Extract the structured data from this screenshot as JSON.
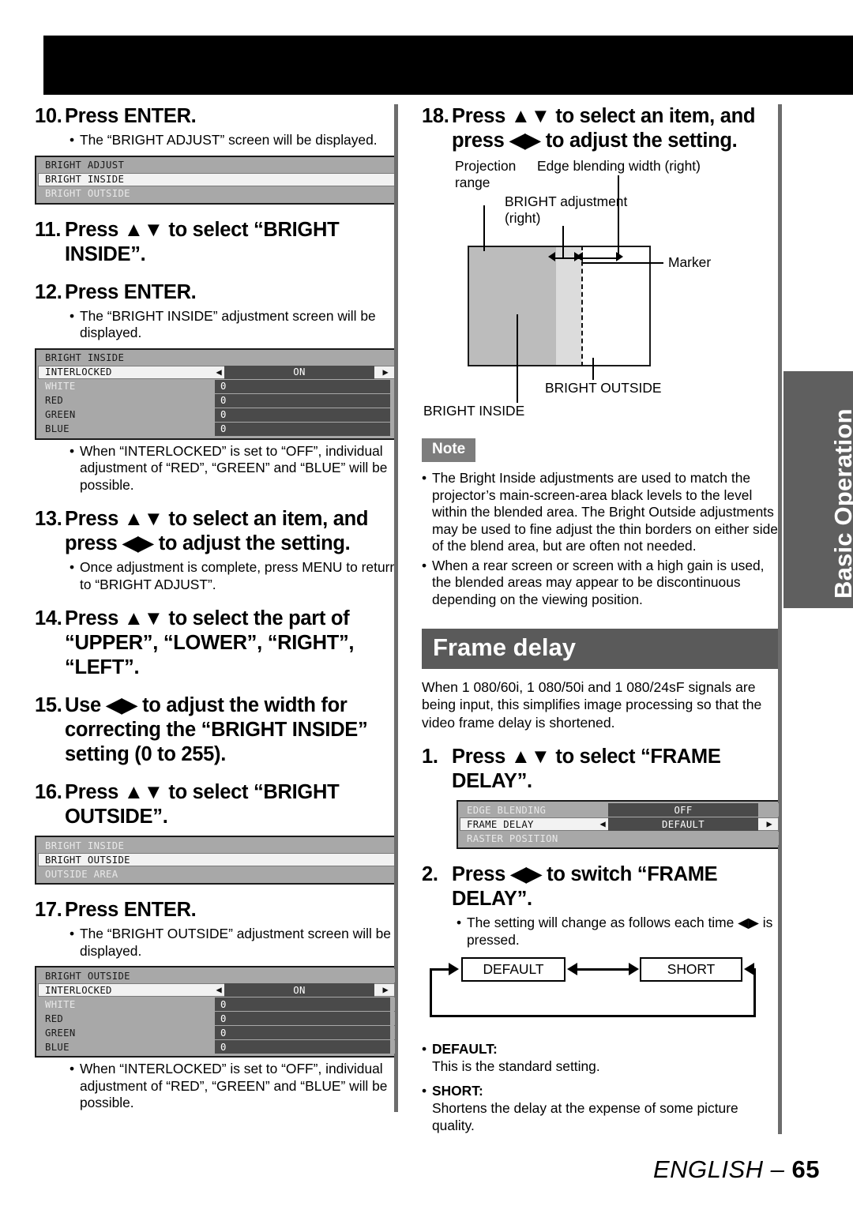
{
  "page": {
    "footer_label": "ENGLISH –",
    "footer_page": "65",
    "side_tab": "Basic Operation"
  },
  "left_column": {
    "step10": {
      "num": "10.",
      "text": "Press ENTER.",
      "bullet": "The “BRIGHT ADJUST” screen will be displayed.",
      "osd": {
        "name": "bright-adjust-menu",
        "title": "BRIGHT ADJUST",
        "rows": [
          {
            "label": "BRIGHT INSIDE",
            "state": "selected"
          },
          {
            "label": "BRIGHT OUTSIDE",
            "state": "dim"
          }
        ]
      }
    },
    "step11": {
      "num": "11.",
      "text": "Press ▲▼ to select “BRIGHT INSIDE”."
    },
    "step12": {
      "num": "12.",
      "text": "Press ENTER.",
      "bullet": "The “BRIGHT INSIDE” adjustment screen will be displayed.",
      "osd": {
        "name": "bright-inside-menu",
        "title": "BRIGHT INSIDE",
        "rows": [
          {
            "label": "INTERLOCKED",
            "value": "ON",
            "state": "selected",
            "arrows": true
          },
          {
            "label": "WHITE",
            "value": "0",
            "state": "dim"
          },
          {
            "label": "RED",
            "value": "0",
            "state": "plain"
          },
          {
            "label": "GREEN",
            "value": "0",
            "state": "plain"
          },
          {
            "label": "BLUE",
            "value": "0",
            "state": "plain"
          }
        ]
      },
      "note_bullet": "When “INTERLOCKED” is set to “OFF”, individual adjustment of “RED”, “GREEN” and “BLUE” will be possible."
    },
    "step13": {
      "num": "13.",
      "text": "Press ▲▼ to select an item, and press ◀▶ to adjust the setting.",
      "bullet": "Once adjustment is complete, press MENU to return to “BRIGHT ADJUST”."
    },
    "step14": {
      "num": "14.",
      "text": "Press ▲▼ to select the part of “UPPER”, “LOWER”, “RIGHT”, “LEFT”."
    },
    "step15": {
      "num": "15.",
      "text": "Use ◀▶ to adjust the width for correcting the “BRIGHT INSIDE” setting (0 to 255)."
    },
    "step16": {
      "num": "16.",
      "text": "Press ▲▼ to select “BRIGHT OUTSIDE”.",
      "osd": {
        "name": "bright-outside-select-menu",
        "rows": [
          {
            "label": "BRIGHT INSIDE",
            "state": "dim"
          },
          {
            "label": "BRIGHT OUTSIDE",
            "state": "selected"
          },
          {
            "label": "OUTSIDE AREA",
            "state": "dim"
          }
        ]
      }
    },
    "step17": {
      "num": "17.",
      "text": "Press ENTER.",
      "bullet": "The “BRIGHT OUTSIDE” adjustment screen will be displayed.",
      "osd": {
        "name": "bright-outside-menu",
        "title": "BRIGHT OUTSIDE",
        "rows": [
          {
            "label": "INTERLOCKED",
            "value": "ON",
            "state": "selected",
            "arrows": true
          },
          {
            "label": "WHITE",
            "value": "0",
            "state": "dim"
          },
          {
            "label": "RED",
            "value": "0",
            "state": "plain"
          },
          {
            "label": "GREEN",
            "value": "0",
            "state": "plain"
          },
          {
            "label": "BLUE",
            "value": "0",
            "state": "plain"
          }
        ]
      },
      "note_bullet": "When “INTERLOCKED” is set to “OFF”, individual adjustment of “RED”, “GREEN” and “BLUE” will be possible."
    }
  },
  "right_column": {
    "step18": {
      "num": "18.",
      "text": "Press ▲▼ to select an item, and press ◀▶ to adjust the setting."
    },
    "diagram": {
      "label_projection_range": "Projection\nrange",
      "label_edge_blending_width": "Edge blending width (right)",
      "label_bright_adjustment": "BRIGHT adjustment\n(right)",
      "label_marker": "Marker",
      "label_bright_outside": "BRIGHT OUTSIDE",
      "label_bright_inside": "BRIGHT INSIDE"
    },
    "note": {
      "badge": "Note",
      "items": [
        "The Bright Inside adjustments are used to match the projector’s main-screen-area black levels to the level within the blended area. The Bright Outside adjustments may be used to fine adjust the thin borders on either side of the blend area, but are often not needed.",
        "When a rear screen or screen with a high gain is used, the blended areas may appear to be discontinuous depending on the viewing position."
      ]
    },
    "frame_delay": {
      "banner": "Frame delay",
      "intro": "When 1 080/60i, 1 080/50i and 1 080/24sF signals are being input, this simplifies image processing so that the video frame delay is shortened.",
      "step1": {
        "num": "1.",
        "text": "Press ▲▼ to select “FRAME DELAY”.",
        "osd": {
          "name": "frame-delay-menu",
          "rows": [
            {
              "label": "EDGE BLENDING",
              "value": "OFF",
              "state": "dim"
            },
            {
              "label": "FRAME DELAY",
              "value": "DEFAULT",
              "state": "selected",
              "arrows": true
            },
            {
              "label": "RASTER POSITION",
              "state": "dim"
            }
          ]
        }
      },
      "step2": {
        "num": "2.",
        "text": "Press ◀▶ to switch “FRAME DELAY”.",
        "bullet": "The setting will change as follows each time ◀▶ is pressed."
      },
      "flow": {
        "box1": "DEFAULT",
        "box2": "SHORT"
      },
      "terms": [
        {
          "name": "DEFAULT:",
          "desc": "This is the standard setting."
        },
        {
          "name": "SHORT:",
          "desc": "Shortens the delay at the expense of some picture quality."
        }
      ]
    }
  }
}
